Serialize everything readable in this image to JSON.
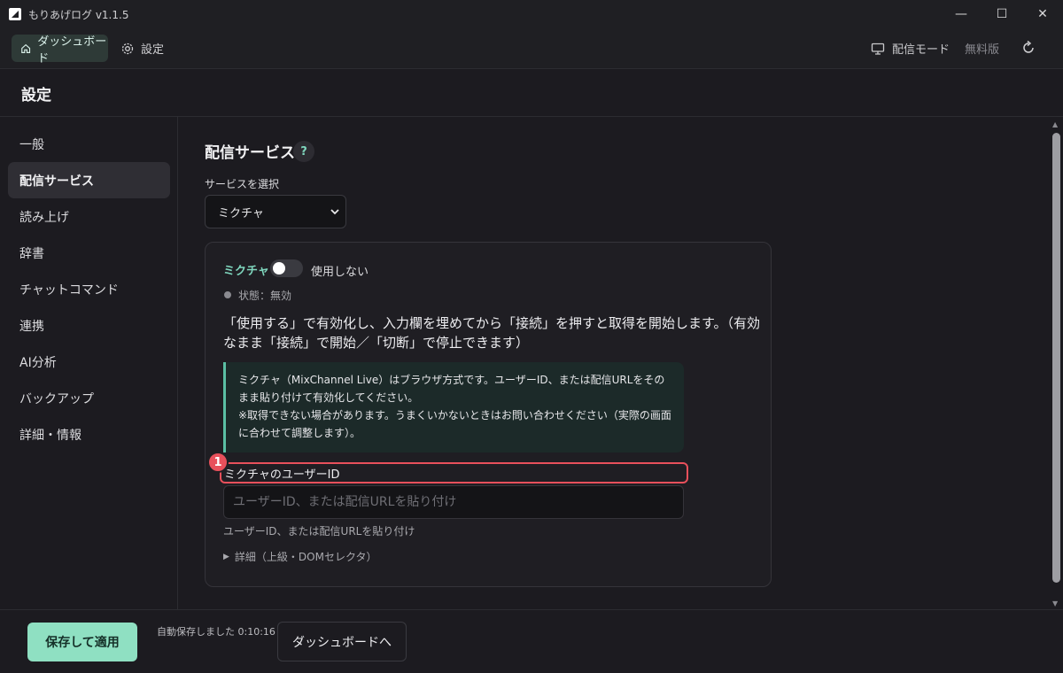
{
  "window": {
    "title": "もりあげログ  v1.1.5",
    "controls": {
      "minimize": "—",
      "maximize": "☐",
      "close": "✕"
    }
  },
  "topnav": {
    "dashboard_label": "ダッシュボード",
    "settings_label": "設定",
    "stream_mode_label": "配信モード",
    "plan_label": "無料版"
  },
  "header": {
    "title": "設定"
  },
  "sidebar": {
    "items": [
      {
        "label": "一般"
      },
      {
        "label": "配信サービス"
      },
      {
        "label": "読み上げ"
      },
      {
        "label": "辞書"
      },
      {
        "label": "チャットコマンド"
      },
      {
        "label": "連携"
      },
      {
        "label": "AI分析"
      },
      {
        "label": "バックアップ"
      },
      {
        "label": "詳細・情報"
      }
    ],
    "active_index": 1
  },
  "main": {
    "section_title": "配信サービス",
    "help_label": "?",
    "select_label": "サービスを選択",
    "selected_service": "ミクチャ",
    "card": {
      "service_name": "ミクチャ",
      "toggle_label": "使用しない",
      "toggle_on": false,
      "status_text": "状態：無効",
      "description": "「使用する」で有効化し、入力欄を埋めてから「接続」を押すと取得を開始します。（有効なまま「接続」で開始／「切断」で停止できます）",
      "info_line1": "ミクチャ（MixChannel Live）はブラウザ方式です。ユーザーID、または配信URLをそのまま貼り付けて有効化してください。",
      "info_line2": "※取得できない場合があります。うまくいかないときはお問い合わせください（実際の画面に合わせて調整します）。",
      "field_label": "ミクチャのユーザーID",
      "marker_number": "1",
      "input_placeholder": "ユーザーID、または配信URLを貼り付け",
      "input_value": "",
      "help_text": "ユーザーID、または配信URLを貼り付け",
      "details_label": "詳細（上級・DOMセレクタ）"
    }
  },
  "footer": {
    "save_label": "保存して適用",
    "autosave_text": "自動保存しました 0:10:16",
    "dashboard_button_label": "ダッシュボードへ"
  },
  "colors": {
    "accent": "#7fd6bd",
    "primary_button": "#8fe0c2",
    "highlight_marker": "#e8505b",
    "background": "#1c1b20"
  }
}
